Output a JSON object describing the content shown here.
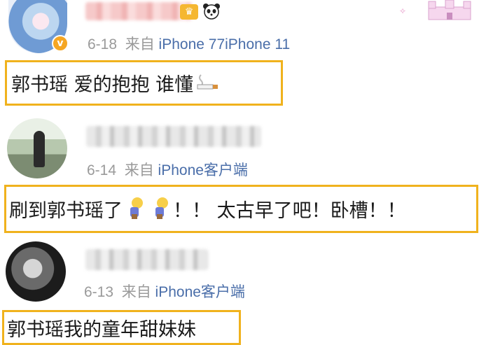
{
  "comments": [
    {
      "date": "6-18",
      "from_label": "来自",
      "source": "iPhone 77iPhone 11",
      "text": "郭书瑶 爱的抱抱 谁懂",
      "verified": "v"
    },
    {
      "date": "6-14",
      "from_label": "来自",
      "source": "iPhone客户端",
      "text": "刷到郭书瑶了",
      "text_after": "！！ 太古早了吧！卧槽！！"
    },
    {
      "date": "6-13",
      "from_label": "来自",
      "source": "iPhone客户端",
      "text": "郭书瑶我的童年甜妹妹"
    }
  ],
  "colors": {
    "highlight_border": "#f0b21d",
    "meta_gray": "#9a9a9a",
    "source_blue": "#4a6ea9",
    "verified_badge": "#f5a623"
  },
  "icons": [
    "verified-badge-icon",
    "panda-icon",
    "cigarette-icon",
    "thinking-emoji-icon"
  ]
}
